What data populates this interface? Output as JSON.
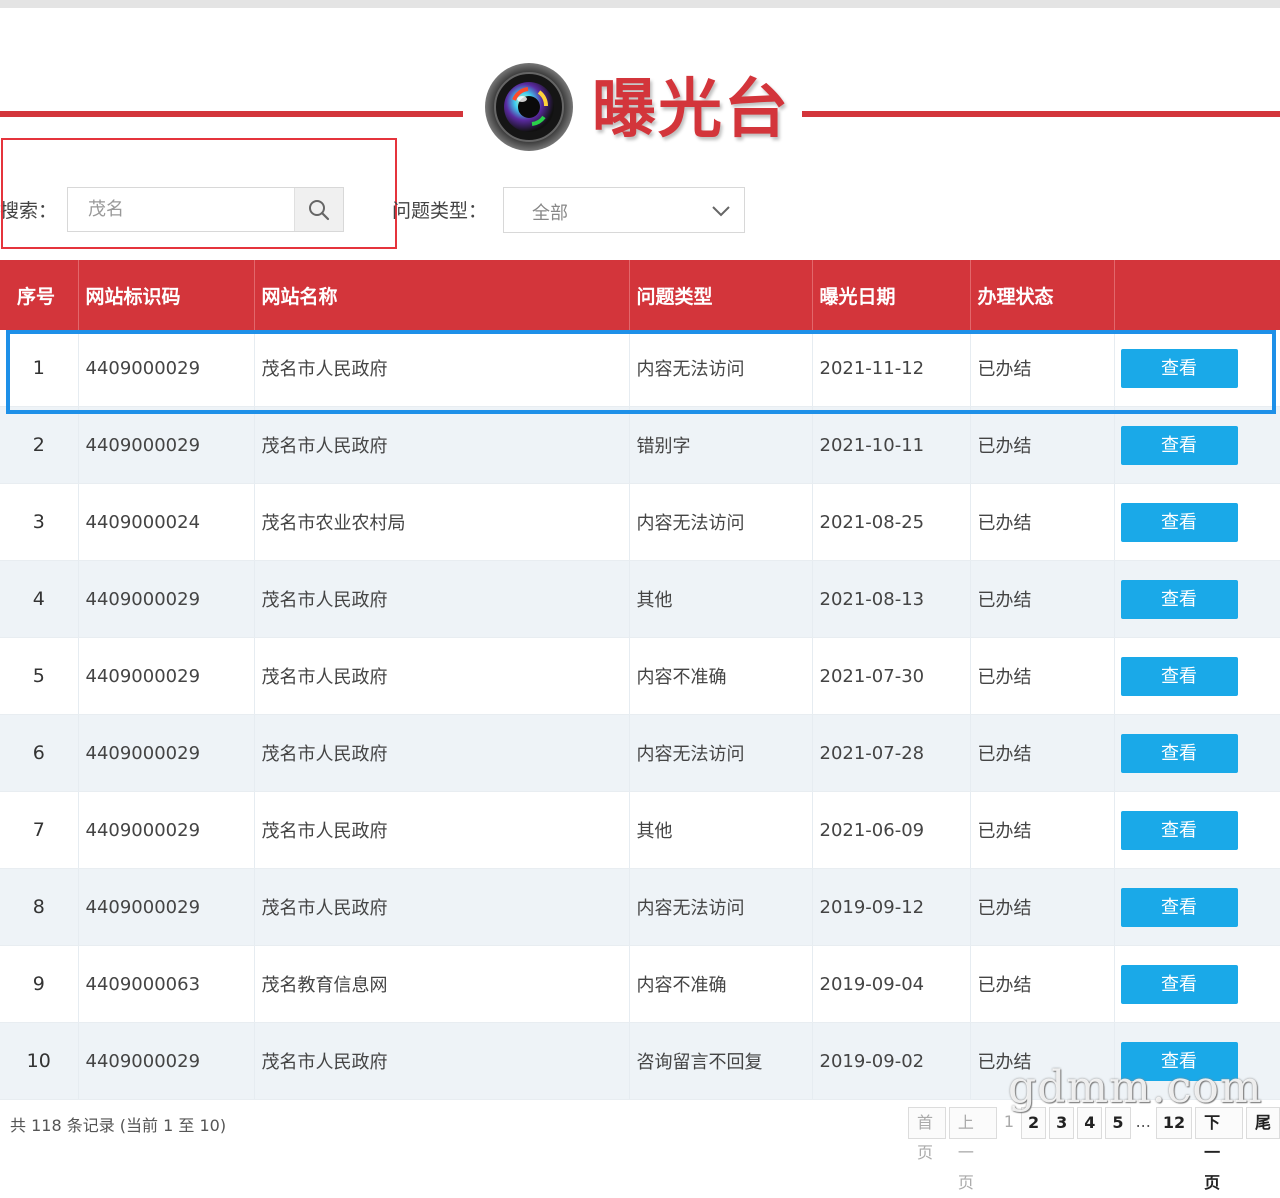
{
  "header": {
    "title": "曝光台",
    "logo_icon": "camera-lens-icon"
  },
  "search": {
    "label": "搜索：",
    "label_visible": "搜索：",
    "placeholder": "茂名"
  },
  "filter": {
    "label": "问题类型：",
    "selected": "全部"
  },
  "table": {
    "columns": [
      "序号",
      "网站标识码",
      "网站名称",
      "问题类型",
      "曝光日期",
      "办理状态",
      ""
    ],
    "rows": [
      {
        "no": "1",
        "code": "4409000029",
        "name": "茂名市人民政府",
        "type": "内容无法访问",
        "date": "2021-11-12",
        "status": "已办结",
        "action": "查看"
      },
      {
        "no": "2",
        "code": "4409000029",
        "name": "茂名市人民政府",
        "type": "错别字",
        "date": "2021-10-11",
        "status": "已办结",
        "action": "查看"
      },
      {
        "no": "3",
        "code": "4409000024",
        "name": "茂名市农业农村局",
        "type": "内容无法访问",
        "date": "2021-08-25",
        "status": "已办结",
        "action": "查看"
      },
      {
        "no": "4",
        "code": "4409000029",
        "name": "茂名市人民政府",
        "type": "其他",
        "date": "2021-08-13",
        "status": "已办结",
        "action": "查看"
      },
      {
        "no": "5",
        "code": "4409000029",
        "name": "茂名市人民政府",
        "type": "内容不准确",
        "date": "2021-07-30",
        "status": "已办结",
        "action": "查看"
      },
      {
        "no": "6",
        "code": "4409000029",
        "name": "茂名市人民政府",
        "type": "内容无法访问",
        "date": "2021-07-28",
        "status": "已办结",
        "action": "查看"
      },
      {
        "no": "7",
        "code": "4409000029",
        "name": "茂名市人民政府",
        "type": "其他",
        "date": "2021-06-09",
        "status": "已办结",
        "action": "查看"
      },
      {
        "no": "8",
        "code": "4409000029",
        "name": "茂名市人民政府",
        "type": "内容无法访问",
        "date": "2019-09-12",
        "status": "已办结",
        "action": "查看"
      },
      {
        "no": "9",
        "code": "4409000063",
        "name": "茂名教育信息网",
        "type": "内容不准确",
        "date": "2019-09-04",
        "status": "已办结",
        "action": "查看"
      },
      {
        "no": "10",
        "code": "4409000029",
        "name": "茂名市人民政府",
        "type": "咨询留言不回复",
        "date": "2019-09-02",
        "status": "已办结",
        "action": "查看"
      }
    ]
  },
  "footer": {
    "records": "共 118 条记录 (当前 1 至 10)",
    "pager": {
      "first": "首页",
      "prev": "上一页",
      "current": "1",
      "pages": [
        "2",
        "3",
        "4",
        "5"
      ],
      "ellipsis": "...",
      "last_page": "12",
      "next": "下一页",
      "end": "尾"
    }
  },
  "watermark": "gdmm.com",
  "colors": {
    "brand_red": "#d3353b",
    "button_blue": "#1aa9e8",
    "annotation_red": "#e5343c",
    "annotation_blue": "#1e90e8"
  }
}
